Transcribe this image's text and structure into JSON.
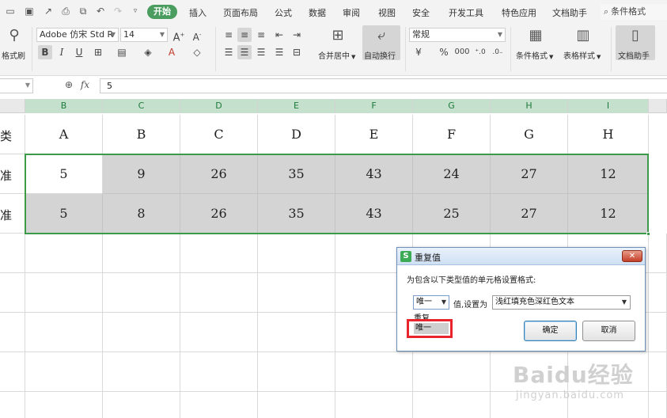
{
  "menubar": {
    "tabs": [
      "开始",
      "插入",
      "页面布局",
      "公式",
      "数据",
      "审阅",
      "视图",
      "安全",
      "开发工具",
      "特色应用",
      "文档助手"
    ],
    "search_placeholder": "条件格式"
  },
  "ribbon": {
    "format_painter": "格式刷",
    "font_name": "Adobe 仿宋 Std R",
    "font_size": "14",
    "merge_center": "合并居中",
    "wrap_text": "自动换行",
    "number_format": "常规",
    "percent": "%",
    "thousands": "000",
    "conditional_format": "条件格式",
    "table_style": "表格样式",
    "doc_helper": "文档助手"
  },
  "formula_bar": {
    "fx": "fx",
    "value": "5"
  },
  "sheet": {
    "columns": [
      "B",
      "C",
      "D",
      "E",
      "F",
      "G",
      "H",
      "I"
    ],
    "row_labels": [
      "类",
      "准",
      "准"
    ],
    "rows": [
      [
        "A",
        "B",
        "C",
        "D",
        "E",
        "F",
        "G",
        "H"
      ],
      [
        "5",
        "9",
        "26",
        "35",
        "43",
        "24",
        "27",
        "12"
      ],
      [
        "5",
        "8",
        "26",
        "35",
        "43",
        "25",
        "27",
        "12"
      ]
    ]
  },
  "dialog": {
    "logo": "S",
    "title": "重复值",
    "description": "为包含以下类型值的单元格设置格式:",
    "selected_type": "唯一",
    "value_label": "值,设置为",
    "format_value": "浅红填充色深红色文本",
    "options": [
      "重复",
      "唯一"
    ],
    "ok_label": "确定",
    "cancel_label": "取消"
  },
  "watermark": {
    "logo": "Baidu经验",
    "url": "jingyan.baidu.com"
  },
  "colors": {
    "accent_green": "#4a9d5f",
    "selection_green": "#3c9b48",
    "highlight_red": "#e8242c",
    "cell_grey": "#d4d4d4"
  }
}
